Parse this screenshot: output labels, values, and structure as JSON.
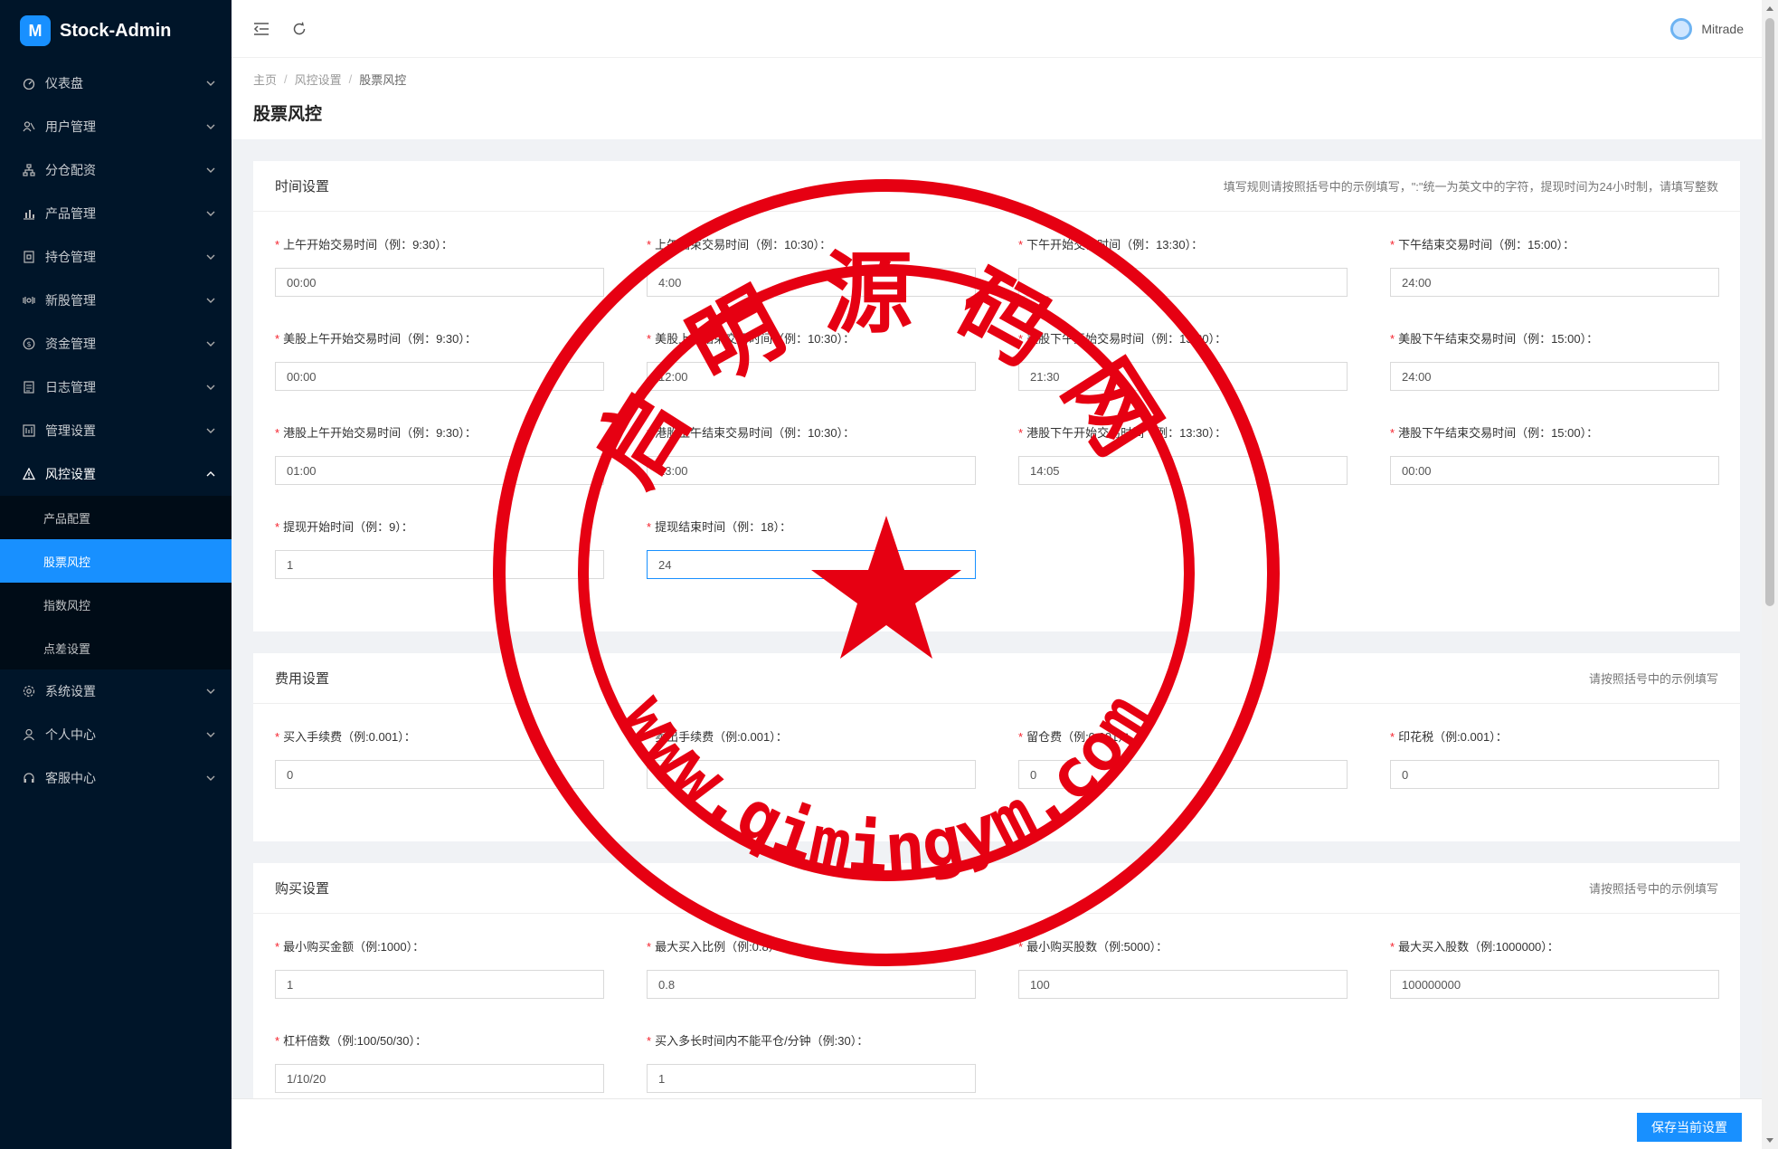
{
  "app": {
    "name": "Stock-Admin",
    "logo_letter": "M"
  },
  "sidebar": {
    "items": [
      {
        "label": "仪表盘",
        "icon": "dashboard-icon"
      },
      {
        "label": "用户管理",
        "icon": "users-icon"
      },
      {
        "label": "分仓配资",
        "icon": "sitemap-icon"
      },
      {
        "label": "产品管理",
        "icon": "bar-chart-icon"
      },
      {
        "label": "持仓管理",
        "icon": "position-icon"
      },
      {
        "label": "新股管理",
        "icon": "ipo-icon"
      },
      {
        "label": "资金管理",
        "icon": "money-icon"
      },
      {
        "label": "日志管理",
        "icon": "log-icon"
      },
      {
        "label": "管理设置",
        "icon": "admin-settings-icon"
      },
      {
        "label": "风控设置",
        "icon": "warning-icon"
      },
      {
        "label": "系统设置",
        "icon": "gear-icon"
      },
      {
        "label": "个人中心",
        "icon": "user-icon"
      },
      {
        "label": "客服中心",
        "icon": "headset-icon"
      }
    ],
    "submenu": [
      "产品配置",
      "股票风控",
      "指数风控",
      "点差设置"
    ],
    "active_sub": "股票风控"
  },
  "header": {
    "user": "Mitrade"
  },
  "breadcrumb": [
    "主页",
    "风控设置",
    "股票风控"
  ],
  "page_title": "股票风控",
  "sections": {
    "time": {
      "title": "时间设置",
      "hint": "填写规则请按照括号中的示例填写，\":\"统一为英文中的字符，提现时间为24小时制，请填写整数",
      "fields": [
        {
          "label": "上午开始交易时间（例：9:30）：",
          "value": "00:00"
        },
        {
          "label": "上午结束交易时间（例：10:30）：",
          "value": "4:00"
        },
        {
          "label": "下午开始交易时间（例：13:30）：",
          "value": ""
        },
        {
          "label": "下午结束交易时间（例：15:00）：",
          "value": "24:00"
        },
        {
          "label": "美股上午开始交易时间（例：9:30）：",
          "value": "00:00"
        },
        {
          "label": "美股上午结束交易时间（例：10:30）：",
          "value": "12:00"
        },
        {
          "label": "美股下午开始交易时间（例：13:30）：",
          "value": "21:30"
        },
        {
          "label": "美股下午结束交易时间（例：15:00）：",
          "value": "24:00"
        },
        {
          "label": "港股上午开始交易时间（例：9:30）：",
          "value": "01:00"
        },
        {
          "label": "港股上午结束交易时间（例：10:30）：",
          "value": "23:00"
        },
        {
          "label": "港股下午开始交易时间（例：13:30）：",
          "value": "14:05"
        },
        {
          "label": "港股下午结束交易时间（例：15:00）：",
          "value": "00:00"
        },
        {
          "label": "提现开始时间（例：9）：",
          "value": "1"
        },
        {
          "label": "提现结束时间（例：18）：",
          "value": "24"
        }
      ]
    },
    "fee": {
      "title": "费用设置",
      "hint": "请按照括号中的示例填写",
      "fields": [
        {
          "label": "买入手续费（例:0.001）：",
          "value": "0"
        },
        {
          "label": "卖出手续费（例:0.001）：",
          "value": "0"
        },
        {
          "label": "留仓费（例:0.001）：",
          "value": "0"
        },
        {
          "label": "印花税（例:0.001）：",
          "value": "0"
        }
      ]
    },
    "buy": {
      "title": "购买设置",
      "hint": "请按照括号中的示例填写",
      "fields": [
        {
          "label": "最小购买金额（例:1000）：",
          "value": "1"
        },
        {
          "label": "最大买入比例（例:0.8）：",
          "value": "0.8"
        },
        {
          "label": "最小购买股数（例:5000）：",
          "value": "100"
        },
        {
          "label": "最大买入股数（例:1000000）：",
          "value": "100000000"
        },
        {
          "label": "杠杆倍数（例:100/50/30）：",
          "value": "1/10/20"
        },
        {
          "label": "买入多长时间内不能平仓/分钟（例:30）：",
          "value": "1"
        }
      ]
    }
  },
  "footer": {
    "save_label": "保存当前设置"
  },
  "watermark": {
    "top_text": "启明源码网",
    "bottom_text": "www.qimingym.com",
    "color": "#e60012"
  }
}
